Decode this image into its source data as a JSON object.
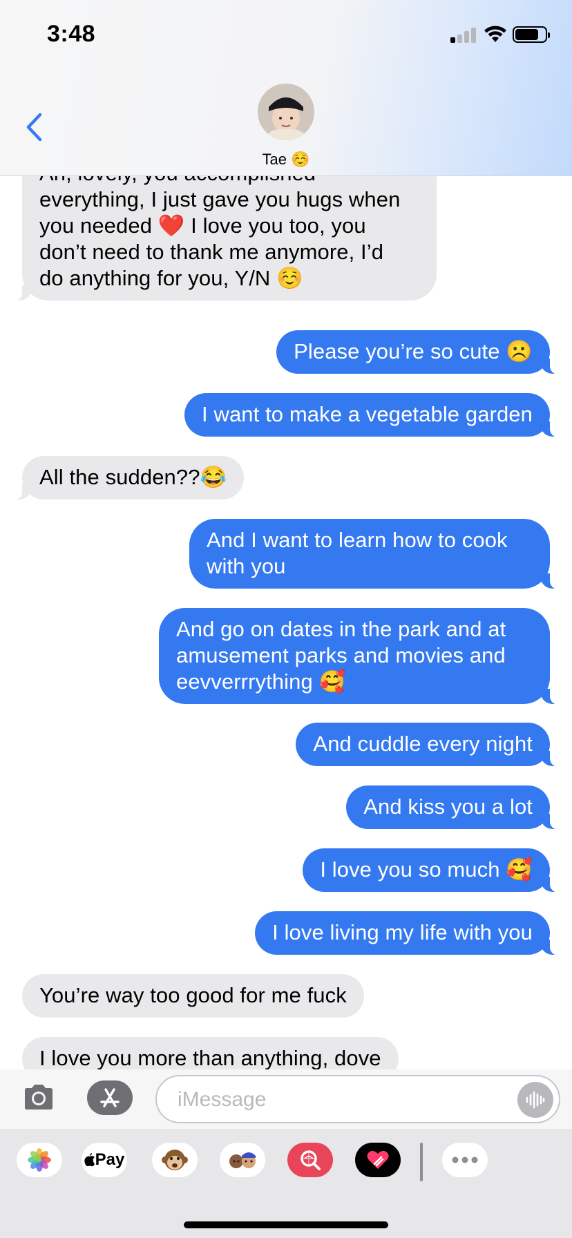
{
  "status_bar": {
    "time": "3:48"
  },
  "header": {
    "contact_name": "Tae ☺️"
  },
  "messages": [
    {
      "dir": "in",
      "text": "Ah, lovely, you accomplished\neverything, I just gave you hugs when\nyou needed ❤️ I love you too, you\ndon’t need to thank me anymore, I’d\ndo anything for you, Y/N ☺️"
    },
    {
      "dir": "out",
      "text": "Please you’re so cute ☹️"
    },
    {
      "dir": "out",
      "text": "I want to make a vegetable garden"
    },
    {
      "dir": "in",
      "text": "All the sudden??😂"
    },
    {
      "dir": "out",
      "text": "And I want to learn how to cook\nwith you"
    },
    {
      "dir": "out",
      "text": "And go on dates in the park and at\namusement parks and movies and\neevverrrything 🥰"
    },
    {
      "dir": "out",
      "text": "And cuddle every night"
    },
    {
      "dir": "out",
      "text": "And kiss you a lot"
    },
    {
      "dir": "out",
      "text": "I love you so much 🥰"
    },
    {
      "dir": "out",
      "text": "I love living my life with you"
    },
    {
      "dir": "in",
      "text": "You’re way too good for me fuck"
    },
    {
      "dir": "in",
      "text": "I love you more than anything, dove"
    }
  ],
  "input": {
    "placeholder": "iMessage"
  },
  "app_strip": {
    "apple_pay_label": "Pay",
    "icons": [
      "photos-icon",
      "apple-pay-icon",
      "monkey-memoji-icon",
      "memoji-icon",
      "image-search-icon",
      "digital-touch-icon",
      "more-icon"
    ]
  },
  "colors": {
    "outgoing": "#3479f0",
    "incoming": "#e9e9eb",
    "back_chevron": "#3478f6"
  }
}
